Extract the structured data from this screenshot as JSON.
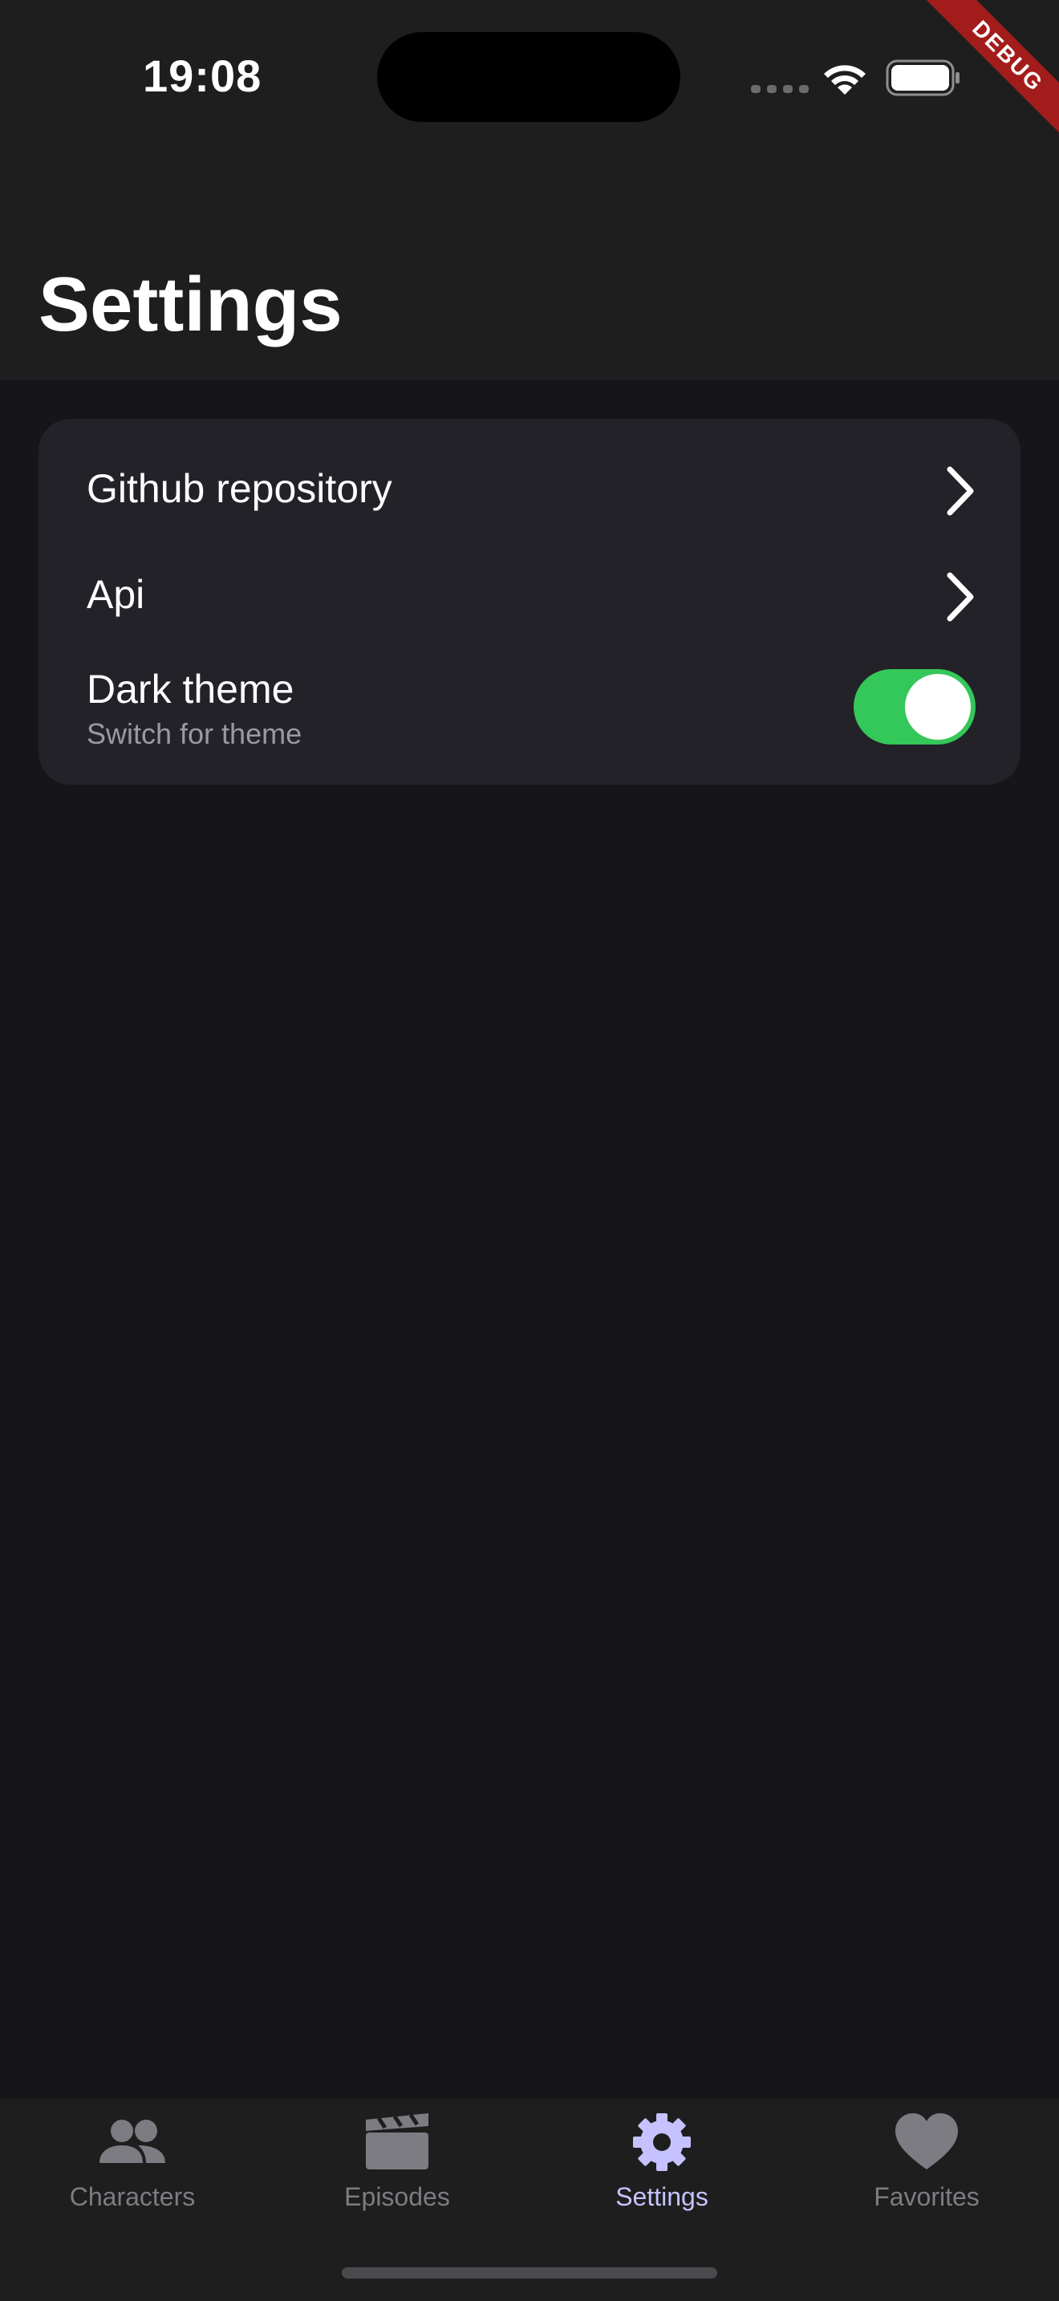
{
  "status_bar": {
    "time": "19:08"
  },
  "debug_banner": "DEBUG",
  "header": {
    "title": "Settings"
  },
  "settings": {
    "items": [
      {
        "label": "Github repository",
        "icon": "chevron-right-icon"
      },
      {
        "label": "Api",
        "icon": "chevron-right-icon"
      },
      {
        "label": "Dark theme",
        "subtitle": "Switch for theme",
        "toggle_on": true
      }
    ]
  },
  "bottom_nav": {
    "items": [
      {
        "label": "Characters",
        "icon": "people-icon",
        "active": false
      },
      {
        "label": "Episodes",
        "icon": "clapperboard-icon",
        "active": false
      },
      {
        "label": "Settings",
        "icon": "gear-icon",
        "active": true
      },
      {
        "label": "Favorites",
        "icon": "heart-icon",
        "active": false
      }
    ]
  },
  "colors": {
    "background": "#16151a",
    "bar": "#1e1e1e",
    "card": "#232228",
    "toggle_on": "#34c759",
    "active_nav": "#c6c2ff",
    "inactive_nav": "#7d7c82",
    "debug": "#a31c1c"
  }
}
